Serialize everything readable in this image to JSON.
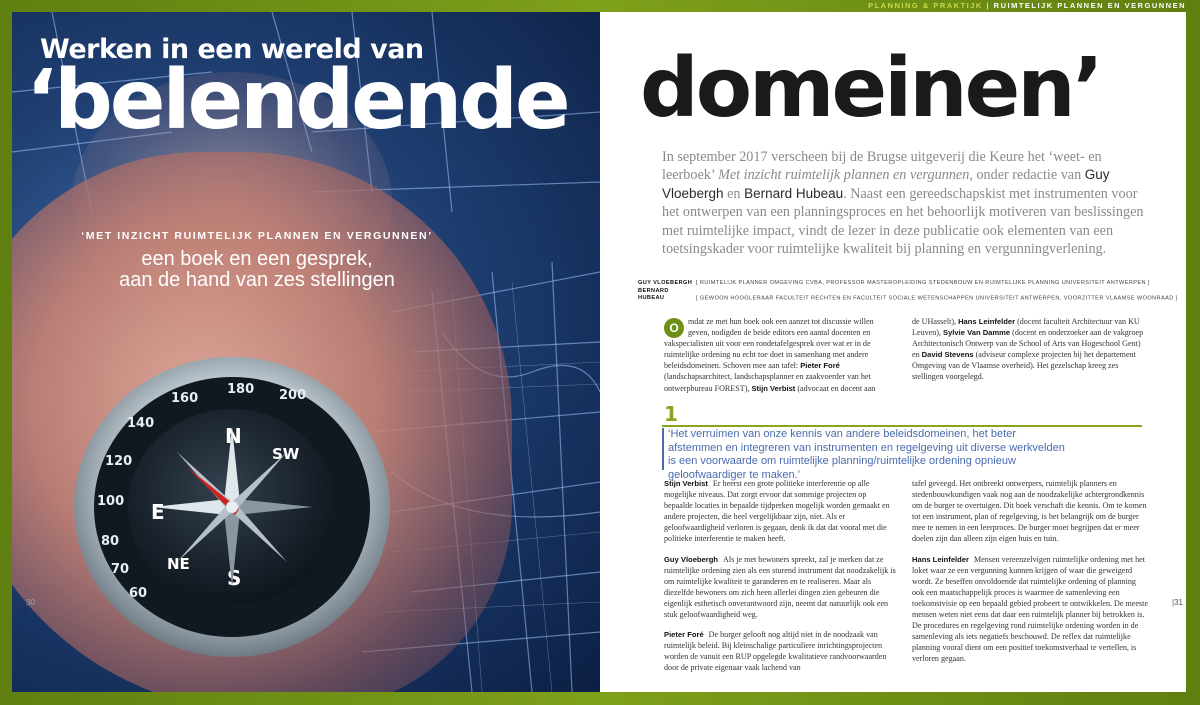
{
  "section_bar": {
    "section": "PLANNING & PRAKTIJK",
    "separator": "|",
    "subsection": "RUIMTELIJK PLANNEN EN VERGUNNEN"
  },
  "headline": {
    "small": "Werken in een wereld van",
    "left_big": "‘belendende",
    "right_big": "domeinen’"
  },
  "cover": {
    "kicker": "‘MET INZICHT RUIMTELIJK PLANNEN EN VERGUNNEN’",
    "subtitle_line1": "een boek en een gesprek,",
    "subtitle_line2": "aan de hand van zes stellingen",
    "compass_letters": {
      "N": "N",
      "E": "E",
      "S": "S",
      "SW": "SW",
      "NE": "NE"
    },
    "compass_numbers": [
      "180",
      "160",
      "140",
      "120",
      "100",
      "80",
      "70",
      "60",
      "200"
    ]
  },
  "intro": {
    "part1": "In september 2017 verscheen bij de Brugse uitgeverij die Keure het ‘weet- en leerboek’ ",
    "book_title": "Met inzicht ruimtelijk plannen en vergunnen",
    "part2": ", onder redactie van",
    "editor1": "Guy Vloebergh",
    "and": " en ",
    "editor2": "Bernard Hubeau",
    "part3": ". Naast een gereedschapskist met instrumenten voor het ontwerpen van een planningsproces en het behoorlijk motiveren van beslissingen met ruimtelijke impact, vindt de lezer in deze publicatie ook elementen van een toetsingskader voor ruimtelijke kwaliteit bij planning en vergunningverlening."
  },
  "authors": [
    {
      "name": "GUY VLOEBERGH",
      "role": "[ RUIMTELIJK PLANNER OMGEVING CVBA, PROFESSOR MASTEROPLEIDING STEDENBOUW EN RUIMTELIJKE PLANNING UNIVERSITEIT ANTWERPEN ]"
    },
    {
      "name": "BERNARD HUBEAU",
      "role": "[ GEWOON HOOGLERAAR FACULTEIT RECHTEN EN FACULTEIT SOCIALE WETENSCHAPPEN UNIVERSITEIT ANTWERPEN, VOORZITTER VLAAMSE WOONRAAD ]"
    }
  ],
  "body_intro": {
    "dropcap": "O",
    "left": "mdat ze met hun boek ook een aanzet tot discussie willen geven, nodigden de beide editors een aantal docenten en vakspecialisten uit voor een rondetafelgesprek over wat er in de ruimtelijke ordening nu echt toe doet in samenhang met andere beleidsdomeinen. Schoven mee aan tafel: ",
    "p1": "Pieter Foré",
    "p1_role": " (landschapsarchitect, landschapsplanner en zaakvoerder van het ontwerpbureau FOREST), ",
    "p2": "Stijn Verbist",
    "p2_role": " (advocaat en docent aan",
    "right_a": "de UHasselt), ",
    "p3": "Hans Leinfelder",
    "p3_role": " (docent faculteit Architectuur van KU Leuven), ",
    "p4": "Sylvie Van Damme",
    "p4_role": " (docent en onderzoeker aan de vakgroep Architectonisch Ontwerp van de School of Arts van Hogeschool Gent) en ",
    "p5": "David Stevens",
    "p5_role": " (adviseur complexe projecten bij het departement Omgeving van de Vlaamse overheid). Het gezelschap kreeg zes stellingen voorgelegd."
  },
  "statement": {
    "number": "1",
    "text": "‘Het verruimen van onze kennis van andere beleidsdomeinen, het beter afstemmen en integreren van instrumenten en regelgeving uit diverse werkvelden is een voorwaarde om ruimtelijke planning/ruimtelijke ordening opnieuw geloofwaardiger te maken.’"
  },
  "discussion_left": [
    {
      "speaker": "Stijn Verbist",
      "text": "Er heerst een grote politieke interferentie op alle mogelijke niveaus. Dat zorgt ervoor dat sommige projecten op bepaalde locaties in bepaalde tijdperken mogelijk worden gemaakt en andere projecten, die heel vergelijkbaar zijn, niet. Als er geloofwaardigheid verloren is gegaan, denk ik dat dat vooral met die politieke interferentie te maken heeft."
    },
    {
      "speaker": "Guy Vloebergh",
      "text": "Als je met bewoners spreekt, zal je merken dat ze ruimtelijke ordening zien als een sturend instrument dat noodzakelijk is om ruimtelijke kwaliteit te garanderen en te realiseren. Maar als diezelfde bewoners om zich heen allerlei dingen zien gebeuren die eigenlijk esthetisch onverantwoord zijn, neemt dat natuurlijk ook een stuk geloofwaardigheid weg."
    },
    {
      "speaker": "Pieter Foré",
      "text": "De burger gelooft nog altijd niet in de noodzaak van ruimtelijk beleid. Bij kleinschalige particuliere inrichtingsprojecten worden de vanuit een RUP opgelegde kwalitatieve randvoorwaarden door de private eigenaar vaak lachend van"
    }
  ],
  "discussion_right": [
    {
      "speaker": "",
      "text": "tafel geveegd. Het ontbreekt ontwerpers, ruimtelijk planners en stedenbouwkundigen vaak nog aan de noodzakelijke achtergrondkennis om de burger te overtuigen. Dit boek verschaft die kennis. Om te komen tot een instrument, plan of regelgeving, is het belangrijk om de burger mee te nemen in een leerproces. De burger moet begrijpen dat er meer doelen zijn dan alleen zijn eigen huis en tuin."
    },
    {
      "speaker": "Hans Leinfelder",
      "text": "Mensen vereenzelvigen ruimtelijke ordening met het loket waar ze een vergunning kunnen krijgen of waar die geweigerd wordt. Ze beseffen onvoldoende dat ruimtelijke ordening of planning ook een maatschappelijk proces is waarmee de samenleving een toekomstvisie op een bepaald gebied probeert te ontwikkelen. De meeste mensen weten niet eens dat daar een ruimtelijk planner bij betrokken is. De procedures en regelgeving rond ruimtelijke ordening worden in de samenleving als iets negatiefs beschouwd. De reflex dat ruimtelijke planning vooral dient om een positief toekomstverhaal te vertellen, is verloren gegaan."
    }
  ],
  "page_numbers": {
    "left": "30",
    "right": "|31"
  },
  "colors": {
    "accent_green": "#8aa41c",
    "quote_blue": "#4a6bb0",
    "frame_green": "#6a8a12"
  }
}
